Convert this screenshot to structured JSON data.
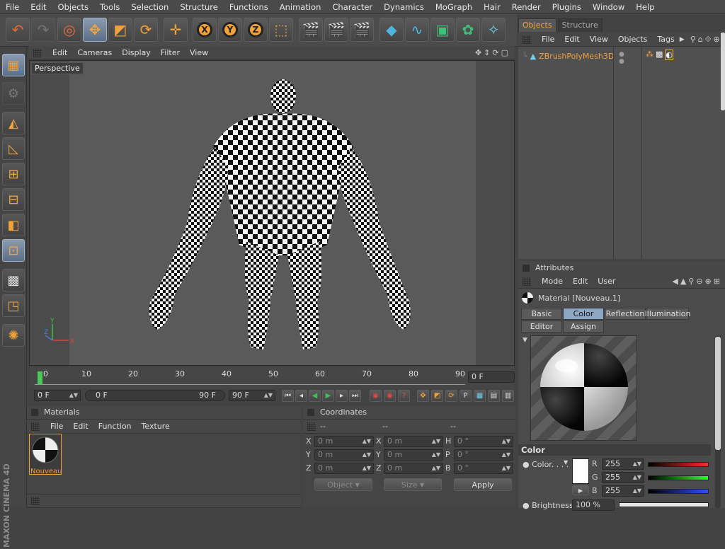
{
  "menu": [
    "File",
    "Edit",
    "Objects",
    "Tools",
    "Selection",
    "Structure",
    "Functions",
    "Animation",
    "Character",
    "Dynamics",
    "MoGraph",
    "Hair",
    "Render",
    "Plugins",
    "Window",
    "Help"
  ],
  "viewport": {
    "menu": [
      "Edit",
      "Cameras",
      "Display",
      "Filter",
      "View"
    ],
    "label": "Perspective",
    "axis_x": "X",
    "axis_y": "Y",
    "axis_z": "Z"
  },
  "timeline": {
    "ticks": [
      "0",
      "10",
      "20",
      "30",
      "40",
      "50",
      "60",
      "70",
      "80",
      "90"
    ],
    "current_frame": "0 F",
    "start_field": "0 F",
    "range_start": "0 F",
    "range_end": "90 F",
    "end_field": "90 F"
  },
  "materials": {
    "title": "Materials",
    "menu": [
      "File",
      "Edit",
      "Function",
      "Texture"
    ],
    "item_name": "Nouveau"
  },
  "coordinates": {
    "title": "Coordinates",
    "col_headers": [
      "--",
      "--",
      "--"
    ],
    "rows": [
      {
        "l1": "X",
        "v1": "0 m",
        "l2": "X",
        "v2": "0 m",
        "l3": "H",
        "v3": "0 °"
      },
      {
        "l1": "Y",
        "v1": "0 m",
        "l2": "Y",
        "v2": "0 m",
        "l3": "P",
        "v3": "0 °"
      },
      {
        "l1": "Z",
        "v1": "0 m",
        "l2": "Z",
        "v2": "0 m",
        "l3": "B",
        "v3": "0 °"
      }
    ],
    "object_dropdown": "Object",
    "size_dropdown": "Size",
    "apply": "Apply"
  },
  "objects": {
    "tabs": [
      "Objects",
      "Structure"
    ],
    "menu": [
      "File",
      "Edit",
      "View",
      "Objects",
      "Tags"
    ],
    "object_name": "ZBrushPolyMesh3D"
  },
  "attributes": {
    "title": "Attributes",
    "menu": [
      "Mode",
      "Edit",
      "User"
    ],
    "material_title": "Material [Nouveau.1]",
    "tabs_row1": [
      "Basic",
      "Color",
      "Reflection",
      "Illumination"
    ],
    "tabs_row2": [
      "Editor",
      "Assign"
    ],
    "section": "Color",
    "color_label": "Color. . . .",
    "r_label": "R",
    "r": "255",
    "g_label": "G",
    "g": "255",
    "b_label": "B",
    "b": "255",
    "brightness_label": "Brightness",
    "brightness": "100 %"
  },
  "brand": "MAXON CINEMA 4D",
  "colors": {
    "accent": "#f2a23a",
    "selected_tab": "#8fa6c2"
  }
}
